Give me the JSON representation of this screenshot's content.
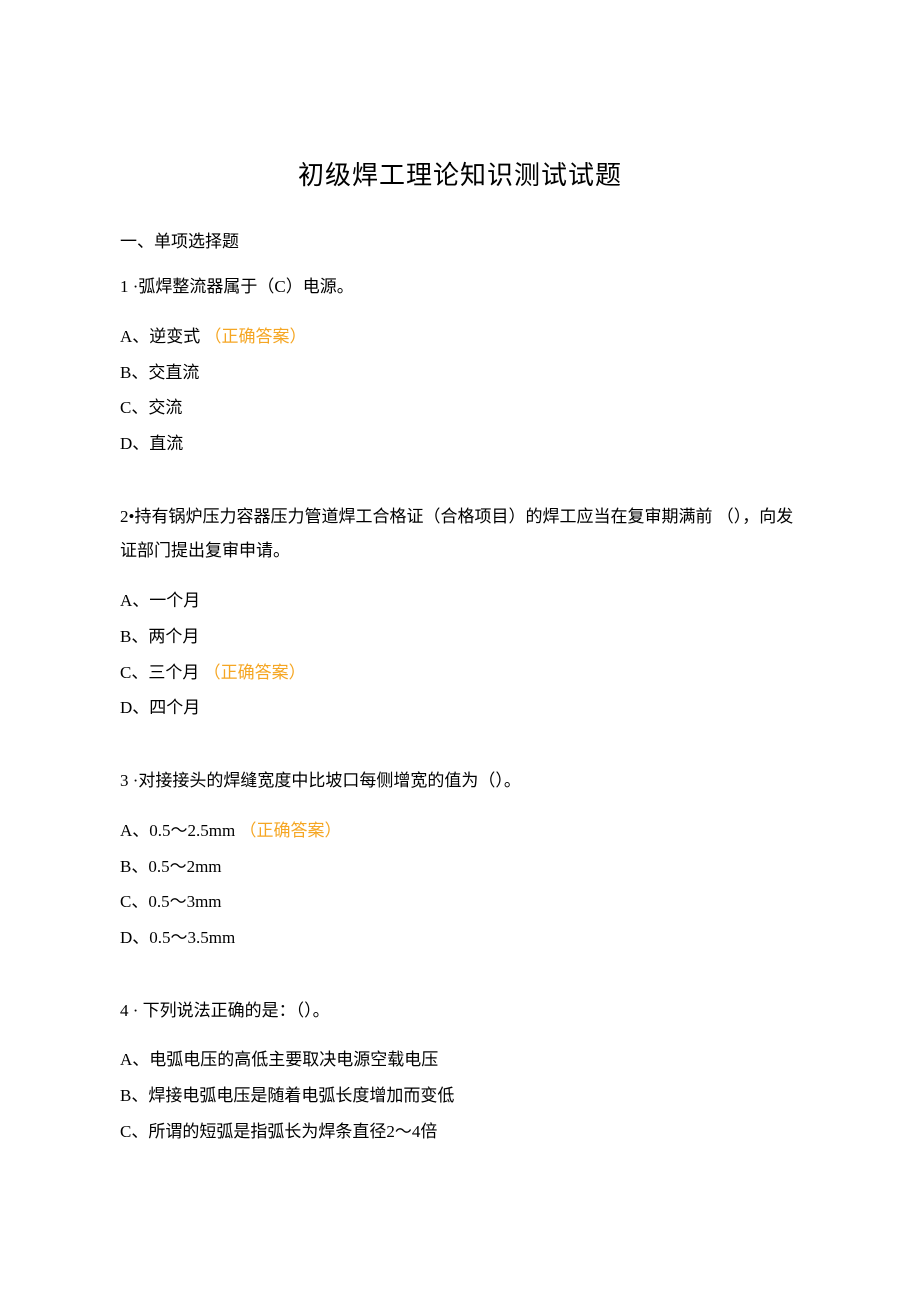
{
  "title": "初级焊工理论知识测试试题",
  "section_heading": "一、单项选择题",
  "correct_label": "（正确答案）",
  "questions": [
    {
      "text": "1 ·弧焊整流器属于（C）电源。",
      "options": [
        {
          "label": "A、逆变式",
          "correct": true
        },
        {
          "label": "B、交直流",
          "correct": false
        },
        {
          "label": "C、交流",
          "correct": false
        },
        {
          "label": "D、直流",
          "correct": false
        }
      ]
    },
    {
      "text": "2•持有锅炉压力容器压力管道焊工合格证（合格项目）的焊工应当在复审期满前 （），向发证部门提出复审申请。",
      "options": [
        {
          "label": "A、一个月",
          "correct": false
        },
        {
          "label": "B、两个月",
          "correct": false
        },
        {
          "label": "C、三个月",
          "correct": true
        },
        {
          "label": "D、四个月",
          "correct": false
        }
      ]
    },
    {
      "text": "3 ·对接接头的焊缝宽度中比坡口每侧增宽的值为（）。",
      "options": [
        {
          "label": "A、0.5～2.5mm",
          "correct": true
        },
        {
          "label": "B、0.5～2mm",
          "correct": false
        },
        {
          "label": "C、0.5～3mm",
          "correct": false
        },
        {
          "label": "D、0.5～3.5mm",
          "correct": false
        }
      ]
    },
    {
      "text": "4 · 下列说法正确的是：（）。",
      "options": [
        {
          "label": "A、电弧电压的高低主要取决电源空载电压",
          "correct": false
        },
        {
          "label": "B、焊接电弧电压是随着电弧长度增加而变低",
          "correct": false
        },
        {
          "label": "C、所谓的短弧是指弧长为焊条直径2～4倍",
          "correct": false
        }
      ]
    }
  ]
}
